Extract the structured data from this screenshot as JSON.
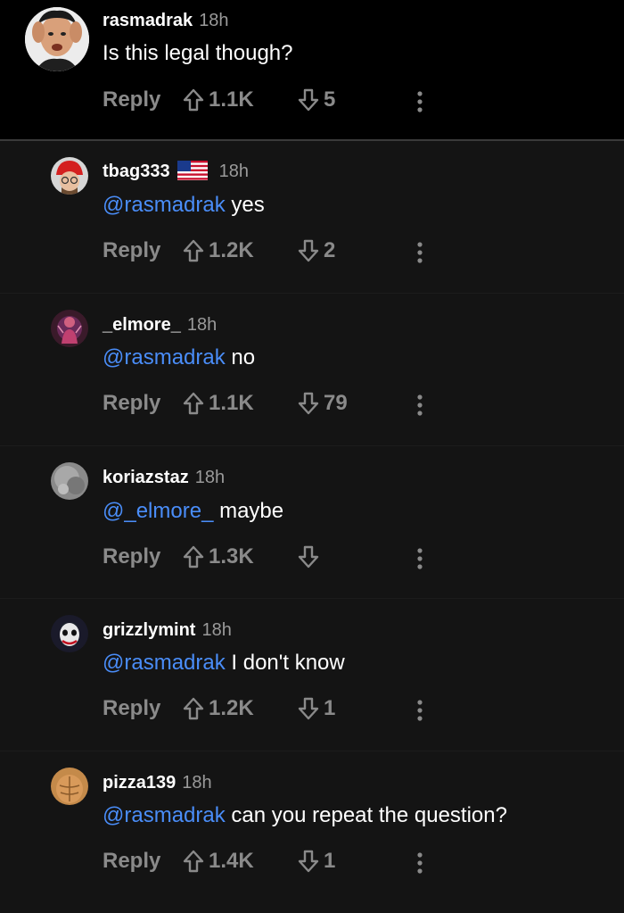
{
  "comments": [
    {
      "username": "rasmadrak",
      "time": "18h",
      "mention": "",
      "text": "Is this legal though?",
      "reply_label": "Reply",
      "upvotes": "1.1K",
      "downvotes": "5",
      "avatar": "jackie-chan-meme-avatar"
    },
    {
      "username": "tbag333",
      "time": "18h",
      "flag": "us-flag-icon",
      "mention": "@rasmadrak",
      "text": " yes",
      "reply_label": "Reply",
      "upvotes": "1.2K",
      "downvotes": "2",
      "avatar": "red-cap-avatar"
    },
    {
      "username": "_elmore_",
      "time": "18h",
      "mention": "@rasmadrak",
      "text": " no",
      "reply_label": "Reply",
      "upvotes": "1.1K",
      "downvotes": "79",
      "avatar": "red-figure-avatar"
    },
    {
      "username": "koriazstaz",
      "time": "18h",
      "mention": "@_elmore_",
      "text": " maybe",
      "reply_label": "Reply",
      "upvotes": "1.3K",
      "downvotes": "",
      "avatar": "grey-blur-avatar"
    },
    {
      "username": "grizzlymint",
      "time": "18h",
      "mention": "@rasmadrak",
      "text": " I don't know",
      "reply_label": "Reply",
      "upvotes": "1.2K",
      "downvotes": "1",
      "avatar": "joker-avatar"
    },
    {
      "username": "pizza139",
      "time": "18h",
      "mention": "@rasmadrak",
      "text": " can you repeat the question?",
      "reply_label": "Reply",
      "upvotes": "1.4K",
      "downvotes": "1",
      "avatar": "muscle-avatar"
    }
  ],
  "colors": {
    "background": "#000000",
    "reply_background": "#141414",
    "mention": "#4a8df8",
    "muted": "#8a8a8a"
  }
}
